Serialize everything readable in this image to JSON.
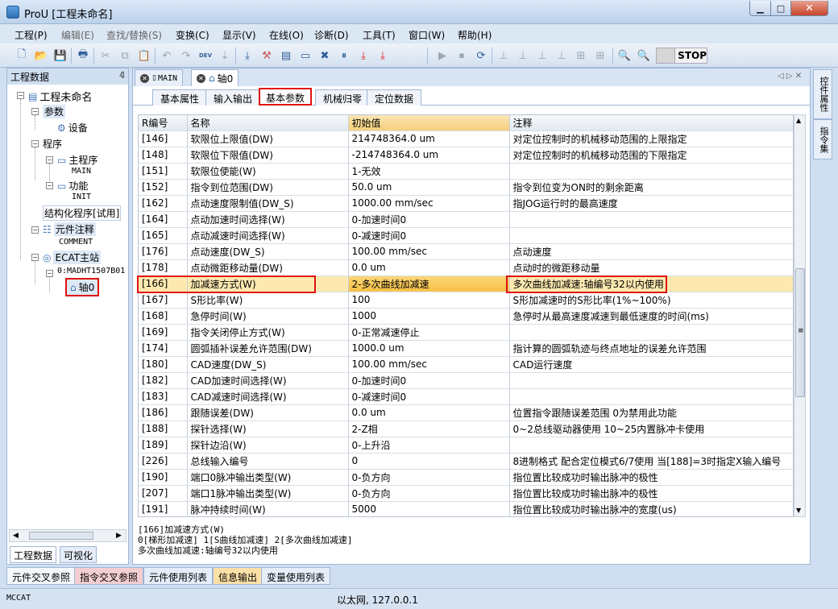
{
  "window": {
    "title": "ProU [工程未命名]"
  },
  "menu": [
    "工程(P)",
    "编辑(E)",
    "查找/替换(S)",
    "变换(C)",
    "显示(V)",
    "在线(O)",
    "诊断(D)",
    "工具(T)",
    "窗口(W)",
    "帮助(H)"
  ],
  "toolbar": {
    "dev_label": "DEV",
    "stop_label": "STOP"
  },
  "left_panel": {
    "title": "工程数据",
    "tree": {
      "root": "工程未命名",
      "param": "参数",
      "device": "设备",
      "program": "程序",
      "main_prog": "主程序",
      "main_code": "MAIN",
      "func": "功能",
      "init_code": "INIT",
      "struct": "结构化程序[试用]",
      "comment_node": "元件注释",
      "comment_code": "COMMENT",
      "ecat": "ECAT主站",
      "ecat_dev": "0:MADHT1507B01",
      "axis": "轴0"
    },
    "tabs": [
      "工程数据",
      "可视化"
    ]
  },
  "doc_tabs": [
    "MAIN",
    "轴0"
  ],
  "sub_tabs": [
    "基本属性",
    "输入输出",
    "基本参数",
    "机械归零",
    "定位数据"
  ],
  "table": {
    "headers": [
      "R编号",
      "名称",
      "初始值",
      "注释"
    ],
    "rows": [
      [
        "[146]",
        "软限位上限值(DW)",
        "214748364.0 um",
        "对定位控制时的机械移动范围的上限指定"
      ],
      [
        "[148]",
        "软限位下限值(DW)",
        "-214748364.0 um",
        "对定位控制时的机械移动范围的下限指定"
      ],
      [
        "[151]",
        "软限位使能(W)",
        "1-无效",
        ""
      ],
      [
        "[152]",
        "指令到位范围(DW)",
        "50.0 um",
        "指令到位变为ON时的剩余距离"
      ],
      [
        "[162]",
        "点动速度限制值(DW_S)",
        "1000.00 mm/sec",
        "指JOG运行时的最高速度"
      ],
      [
        "[164]",
        "点动加速时间选择(W)",
        "0-加速时间0",
        ""
      ],
      [
        "[165]",
        "点动减速时间选择(W)",
        "0-减速时间0",
        ""
      ],
      [
        "[176]",
        "点动速度(DW_S)",
        "100.00 mm/sec",
        "点动速度"
      ],
      [
        "[178]",
        "点动微距移动量(DW)",
        "0.0 um",
        "点动时的微距移动量"
      ],
      [
        "[166]",
        "加减速方式(W)",
        "2-多次曲线加减速",
        "多次曲线加减速:轴编号32以内使用"
      ],
      [
        "[167]",
        "S形比率(W)",
        "100",
        "S形加减速时的S形比率(1%~100%)"
      ],
      [
        "[168]",
        "急停时间(W)",
        "1000",
        "急停时从最高速度减速到最低速度的时间(ms)"
      ],
      [
        "[169]",
        "指令关闭停止方式(W)",
        "0-正常减速停止",
        ""
      ],
      [
        "[174]",
        "圆弧插补误差允许范围(DW)",
        "1000.0 um",
        "指计算的圆弧轨迹与终点地址的误差允许范围"
      ],
      [
        "[180]",
        "CAD速度(DW_S)",
        "100.00 mm/sec",
        "CAD运行速度"
      ],
      [
        "[182]",
        "CAD加速时间选择(W)",
        "0-加速时间0",
        ""
      ],
      [
        "[183]",
        "CAD减速时间选择(W)",
        "0-减速时间0",
        ""
      ],
      [
        "[186]",
        "跟随误差(DW)",
        "0.0 um",
        "位置指令跟随误差范围 0为禁用此功能"
      ],
      [
        "[188]",
        "探针选择(W)",
        "2-Z相",
        "0~2总线驱动器使用 10~25内置脉冲卡使用"
      ],
      [
        "[189]",
        "探针边沿(W)",
        "0-上升沿",
        ""
      ],
      [
        "[226]",
        "总线输入编号",
        "0",
        "8进制格式 配合定位模式6/7使用 当[188]=3时指定X输入编号"
      ],
      [
        "[190]",
        "端口0脉冲输出类型(W)",
        "0-负方向",
        "指位置比较成功时输出脉冲的极性"
      ],
      [
        "[207]",
        "端口1脉冲输出类型(W)",
        "0-负方向",
        "指位置比较成功时输出脉冲的极性"
      ],
      [
        "[191]",
        "脉冲持续时间(W)",
        "5000",
        "指位置比较成功时输出脉冲的宽度(us)"
      ]
    ]
  },
  "info": {
    "line1": "[166]加减速方式(W)",
    "line2": "0[梯形加减速] 1[S曲线加减速] 2[多次曲线加减速]",
    "line3": "多次曲线加减速:轴编号32以内使用"
  },
  "right_tabs": [
    "控件属性",
    "指令集"
  ],
  "bottom_tabs": [
    "元件交叉参照",
    "指令交叉参照",
    "元件使用列表",
    "信息输出",
    "变量使用列表"
  ],
  "status": {
    "left": "MCCAT",
    "center": "以太网, 127.0.0.1"
  }
}
